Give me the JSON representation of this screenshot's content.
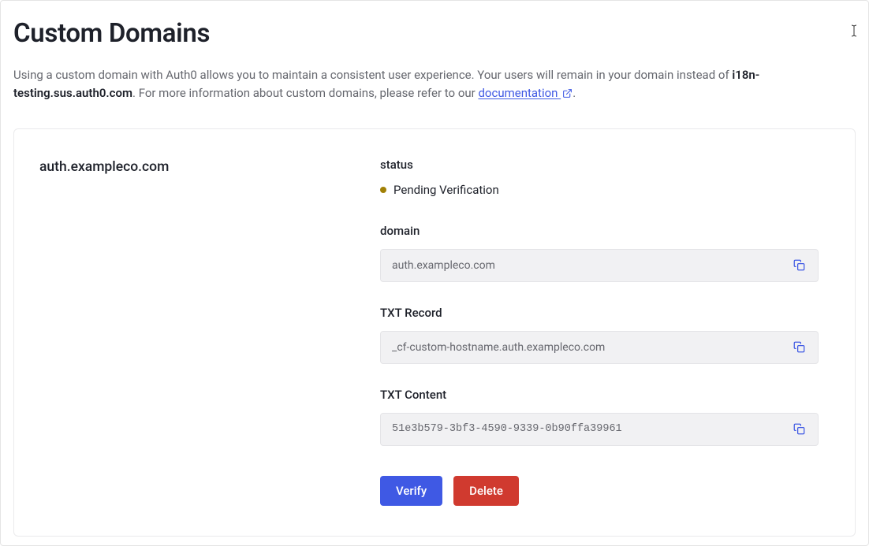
{
  "page": {
    "title": "Custom Domains",
    "description_pre": "Using a custom domain with Auth0 allows you to maintain a consistent user experience. Your users will remain in your domain instead of ",
    "tenant_domain": "i18n-testing.sus.auth0.com",
    "description_mid": ". For more information about custom domains, please refer to our ",
    "doc_link_label": "documentation",
    "description_end": "."
  },
  "card": {
    "domain_name": "auth.exampleco.com",
    "status_label": "status",
    "status_text": "Pending Verification",
    "status_color": "#a18006",
    "fields": {
      "domain": {
        "label": "domain",
        "value": "auth.exampleco.com"
      },
      "txt_record": {
        "label": "TXT Record",
        "value": "_cf-custom-hostname.auth.exampleco.com"
      },
      "txt_content": {
        "label": "TXT Content",
        "value": "51e3b579-3bf3-4590-9339-0b90ffa39961"
      }
    },
    "actions": {
      "verify": "Verify",
      "delete": "Delete"
    }
  }
}
